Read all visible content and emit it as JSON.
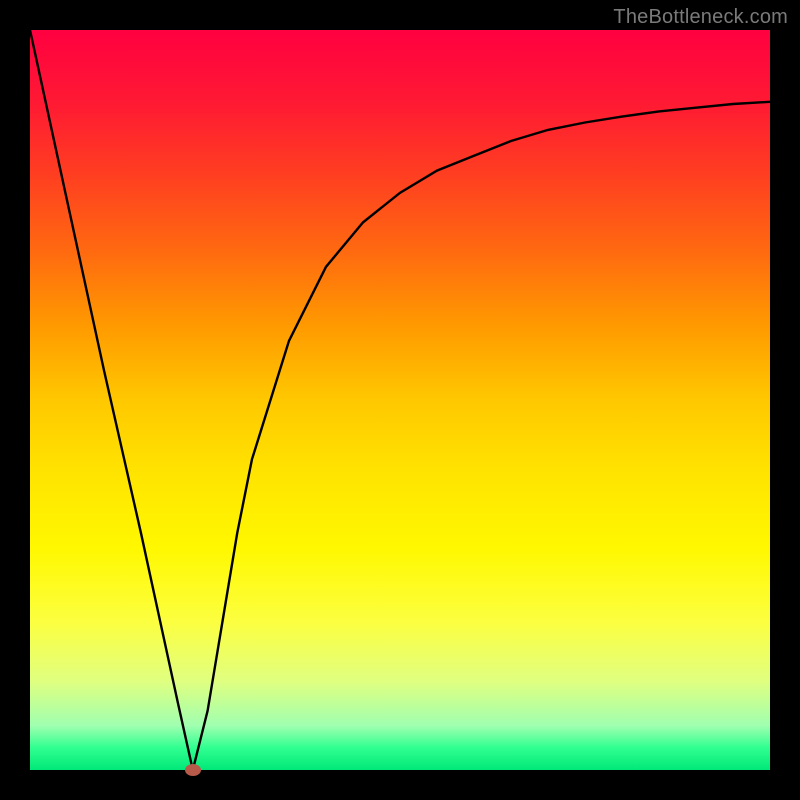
{
  "watermark": "TheBottleneck.com",
  "colors": {
    "frame_bg": "#000000",
    "curve_stroke": "#000000",
    "dot_fill": "#b85a4a"
  },
  "chart_data": {
    "type": "line",
    "title": "",
    "xlabel": "",
    "ylabel": "",
    "xlim": [
      0,
      100
    ],
    "ylim": [
      0,
      100
    ],
    "grid": false,
    "series": [
      {
        "name": "curve",
        "x": [
          0,
          5,
          10,
          15,
          20,
          22,
          24,
          26,
          28,
          30,
          35,
          40,
          45,
          50,
          55,
          60,
          65,
          70,
          75,
          80,
          85,
          90,
          95,
          100
        ],
        "values": [
          100,
          77,
          54,
          32,
          9,
          0,
          8,
          20,
          32,
          42,
          58,
          68,
          74,
          78,
          81,
          83,
          85,
          86.5,
          87.5,
          88.3,
          89,
          89.5,
          90,
          90.3
        ]
      }
    ],
    "marker": {
      "x": 22,
      "y": 0
    }
  }
}
